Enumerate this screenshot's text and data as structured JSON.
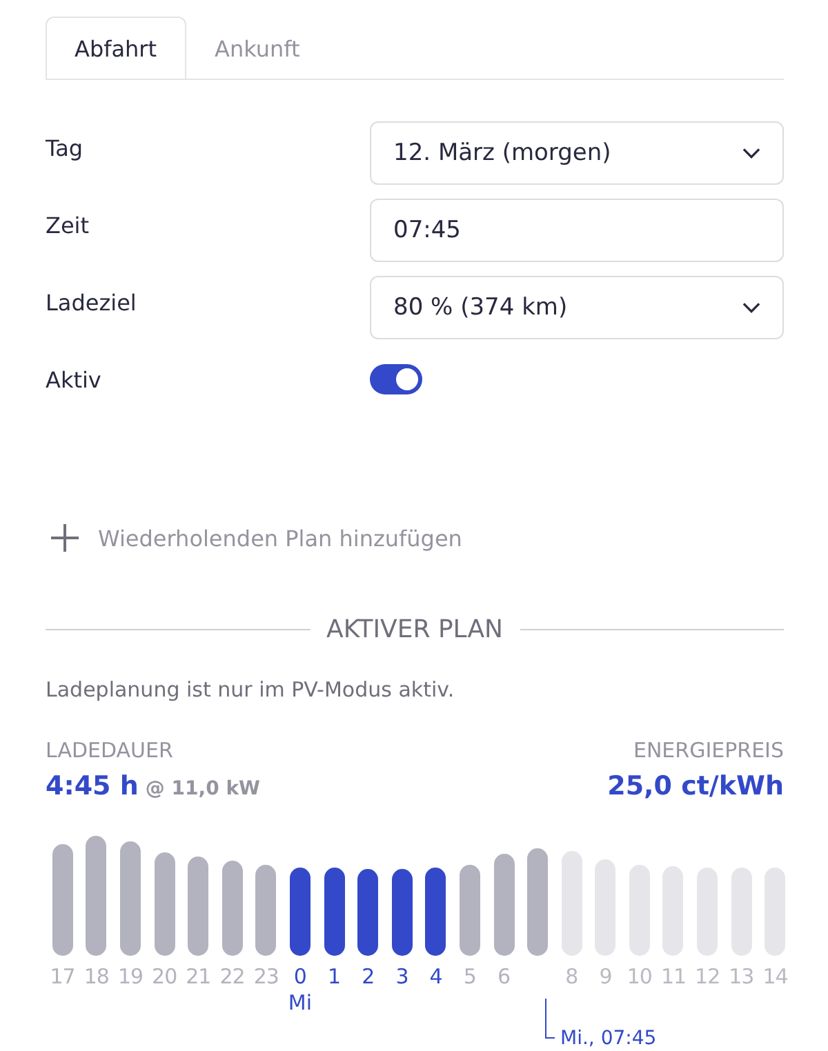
{
  "tabs": [
    {
      "label": "Abfahrt",
      "selected": true
    },
    {
      "label": "Ankunft",
      "selected": false
    }
  ],
  "form": [
    {
      "label": "Tag",
      "kind": "select",
      "value": "12. März (morgen)"
    },
    {
      "label": "Zeit",
      "kind": "input",
      "value": "07:45"
    },
    {
      "label": "Ladeziel",
      "kind": "select",
      "value": "80 % (374 km)"
    },
    {
      "label": "Aktiv",
      "kind": "toggle",
      "on": true
    }
  ],
  "add_plan": "Wiederholenden Plan hinzufügen",
  "section_title": "AKTIVER PLAN",
  "note": "Ladeplanung ist nur im PV-Modus aktiv.",
  "duration": {
    "label": "LADEDAUER",
    "value": "4:45 h",
    "power": "@ 11,0 kW"
  },
  "price": {
    "label": "ENERGIEPREIS",
    "value": "25,0 ct/kWh"
  },
  "slots": [
    {
      "hour": "17",
      "kind": "idle"
    },
    {
      "hour": "18",
      "kind": "idle"
    },
    {
      "hour": "19",
      "kind": "idle"
    },
    {
      "hour": "20",
      "kind": "idle"
    },
    {
      "hour": "21",
      "kind": "idle"
    },
    {
      "hour": "22",
      "kind": "idle"
    },
    {
      "hour": "23",
      "kind": "idle"
    },
    {
      "hour": "0",
      "kind": "charging",
      "day": "Mi"
    },
    {
      "hour": "1",
      "kind": "charging"
    },
    {
      "hour": "2",
      "kind": "charging"
    },
    {
      "hour": "3",
      "kind": "charging"
    },
    {
      "hour": "4",
      "kind": "charging"
    },
    {
      "hour": "5",
      "kind": "idle"
    },
    {
      "hour": "6",
      "kind": "idle"
    },
    {
      "kind": "idle"
    },
    {
      "hour": "8",
      "kind": "future"
    },
    {
      "hour": "9",
      "kind": "future"
    },
    {
      "hour": "10",
      "kind": "future"
    },
    {
      "hour": "11",
      "kind": "future"
    },
    {
      "hour": "12",
      "kind": "future"
    },
    {
      "hour": "13",
      "kind": "future"
    },
    {
      "hour": "14",
      "kind": "future"
    }
  ],
  "departure_marker": "Mi., 07:45"
}
